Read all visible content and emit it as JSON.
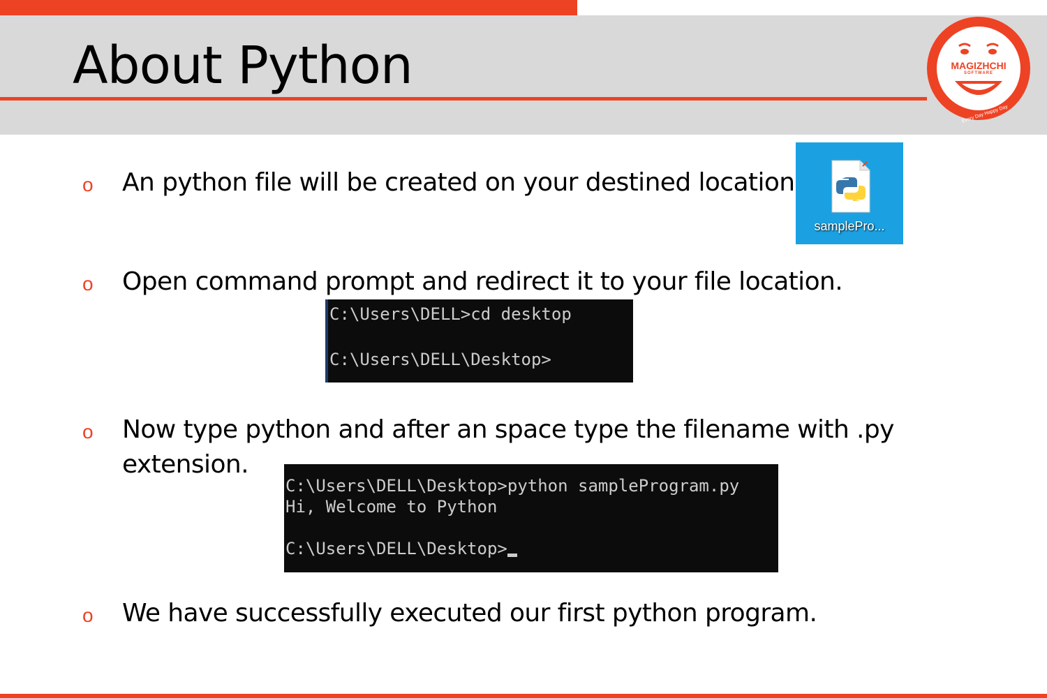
{
  "slide": {
    "title": "About Python"
  },
  "logo": {
    "name": "MAGIZHCHI",
    "subtitle": "SOFTWARE",
    "tagline": "Every Day Happy Day"
  },
  "bullets": [
    {
      "lines": [
        "An python file will be created on your destined location."
      ]
    },
    {
      "lines": [
        "Open command prompt and redirect it to your file location."
      ]
    },
    {
      "lines": [
        "Now type python and after an space type the filename with .py",
        "extension."
      ]
    },
    {
      "lines": [
        "We have successfully executed our first python program."
      ]
    }
  ],
  "file_icon": {
    "icon": "python-file-icon",
    "label": "samplePro..."
  },
  "terminal_1": {
    "lines": [
      "C:\\Users\\DELL>cd desktop",
      "",
      "C:\\Users\\DELL\\Desktop>"
    ]
  },
  "terminal_2": {
    "lines": [
      "C:\\Users\\DELL\\Desktop>python sampleProgram.py",
      "Hi, Welcome to Python",
      "",
      "C:\\Users\\DELL\\Desktop>"
    ]
  },
  "colors": {
    "accent": "#ee4224",
    "header_band": "#d9d9d9",
    "icon_tile": "#1ba1e2",
    "terminal_bg": "#0c0c0c"
  }
}
